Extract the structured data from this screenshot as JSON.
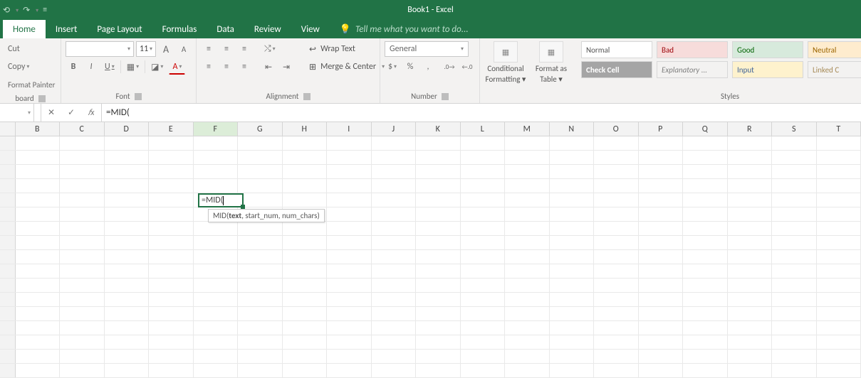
{
  "title": "Book1 - Excel",
  "qat": {
    "undo": "⟲",
    "redo": "↷",
    "customize": "▾",
    "more": "≡"
  },
  "tabs": {
    "home": "Home",
    "insert": "Insert",
    "page_layout": "Page Layout",
    "formulas": "Formulas",
    "data": "Data",
    "review": "Review",
    "view": "View",
    "tell_me": "Tell me what you want to do..."
  },
  "clipboard": {
    "cut": "Cut",
    "copy": "Copy",
    "format_painter": "Format Painter",
    "label": "board"
  },
  "font": {
    "name": "",
    "size": "11",
    "grow": "A▴",
    "shrink": "A▾",
    "bold": "B",
    "italic": "I",
    "underline": "U",
    "borders": "▦",
    "fill": "◪",
    "color": "A",
    "label": "Font"
  },
  "alignment": {
    "top": "≡",
    "middle": "≡",
    "bottom": "≡",
    "orient": "⤭",
    "left": "≡",
    "center": "≡",
    "right": "≡",
    "dec_indent": "⇤",
    "inc_indent": "⇥",
    "wrap_icon": "↩",
    "wrap": "Wrap Text",
    "merge_icon": "⊞",
    "merge": "Merge & Center",
    "label": "Alignment"
  },
  "number": {
    "format": "General",
    "currency": "$",
    "percent": "%",
    "comma": ",",
    "inc_dec": "←0 .00",
    "dec_dec": ".00 →0",
    "label": "Number"
  },
  "cond": {
    "cond_fmt": "Conditional Formatting",
    "cond_fmt_l1": "Conditional",
    "cond_fmt_l2": "Formatting",
    "fmt_table": "Format as Table",
    "fmt_table_l1": "Format as",
    "fmt_table_l2": "Table"
  },
  "styles": {
    "normal": "Normal",
    "bad": "Bad",
    "good": "Good",
    "neutral": "Neutral",
    "check": "Check Cell",
    "explanatory": "Explanatory ...",
    "input": "Input",
    "linked": "Linked C",
    "label": "Styles"
  },
  "fxbar": {
    "name": "",
    "cancel": "✕",
    "enter": "✓",
    "fx": "𝑓x",
    "formula": "=MID("
  },
  "columns": [
    "B",
    "C",
    "D",
    "E",
    "F",
    "G",
    "H",
    "I",
    "J",
    "K",
    "L",
    "M",
    "N",
    "O",
    "P",
    "Q",
    "R",
    "S",
    "T"
  ],
  "active_col": "F",
  "cell_value": "=MID(",
  "tooltip": {
    "prefix": "MID(",
    "bold": "text",
    "rest": ", start_num, num_chars)"
  }
}
